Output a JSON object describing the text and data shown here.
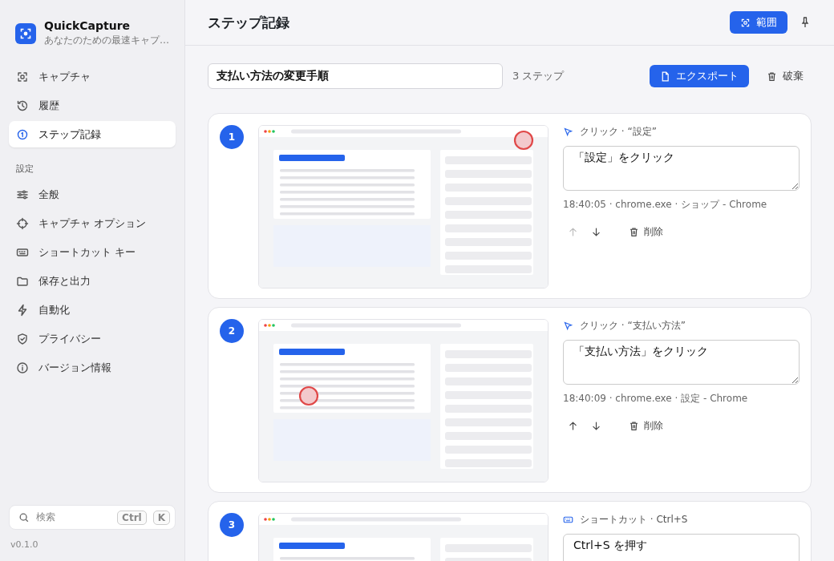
{
  "app": {
    "name": "QuickCapture",
    "tagline": "あなたのための最速キャプ…"
  },
  "nav": [
    {
      "kind": "capture",
      "label": "キャプチャ",
      "selected": false
    },
    {
      "kind": "history",
      "label": "履歴",
      "selected": false
    },
    {
      "kind": "steps",
      "label": "ステップ記録",
      "selected": true
    }
  ],
  "settings": {
    "heading": "設定",
    "items": [
      {
        "kind": "sliders",
        "label": "全般",
        "selected": false
      },
      {
        "kind": "crosshair",
        "label": "キャプチャ オプション",
        "selected": false
      },
      {
        "kind": "keyboard",
        "label": "ショートカット キー",
        "selected": false
      },
      {
        "kind": "folder",
        "label": "保存と出力",
        "selected": false
      },
      {
        "kind": "bolt",
        "label": "自動化",
        "selected": false
      },
      {
        "kind": "shield",
        "label": "プライバシー",
        "selected": false
      },
      {
        "kind": "info",
        "label": "バージョン情報",
        "selected": false
      }
    ]
  },
  "search": {
    "placeholder": "検索",
    "keys": [
      "Ctrl",
      "K"
    ]
  },
  "version": "v0.1.0",
  "header": {
    "title": "ステップ記録",
    "region_button": "範囲"
  },
  "recording": {
    "title": "支払い方法の変更手順",
    "count": "3 ステップ",
    "export_button": "エクスポート",
    "discard_button": "破棄"
  },
  "steps": [
    {
      "number": "1",
      "kind": "click",
      "action": "クリック · “設定”",
      "description": "「設定」をクリック",
      "meta": "18:40:05 · chrome.exe · ショップ - Chrome",
      "up_disabled": true,
      "down_disabled": false,
      "delete": "削除"
    },
    {
      "number": "2",
      "kind": "click",
      "action": "クリック · “支払い方法”",
      "description": "「支払い方法」をクリック",
      "meta": "18:40:09 · chrome.exe · 設定 - Chrome",
      "up_disabled": false,
      "down_disabled": false,
      "delete": "削除"
    },
    {
      "number": "3",
      "kind": "shortcut",
      "action": "ショートカット · Ctrl+S",
      "description": "Ctrl+S を押す"
    }
  ]
}
